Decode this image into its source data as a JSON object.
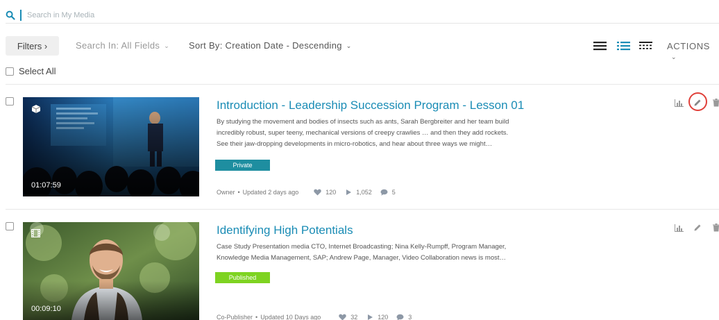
{
  "colors": {
    "accent": "#1a8cb5",
    "private_badge": "#1e8ea0",
    "published_badge": "#7ed321",
    "highlight_circle": "#e0403a"
  },
  "search": {
    "placeholder": "Search in My Media",
    "icon": "search-icon"
  },
  "toolbar": {
    "filters_label": "Filters ›",
    "search_in_label": "Search In: All Fields",
    "sort_by_label": "Sort By: Creation Date - Descending",
    "view_icons": [
      "details-view-icon",
      "list-view-icon",
      "compact-view-icon"
    ],
    "actions_label": "ACTIONS"
  },
  "select_all_label": "Select All",
  "entries": [
    {
      "title": "Introduction - Leadership Succession Program - Lesson 01",
      "description_lines": [
        "By studying the movement and bodies of insects such as ants, Sarah Bergbreiter and her team build",
        "incredibly robust, super teeny, mechanical versions of creepy crawlies … and then they add rockets.",
        "See their jaw-dropping developments in micro-robotics, and hear about three ways we might…"
      ],
      "status": "Private",
      "duration": "01:07:59",
      "type_icon": "cube-icon",
      "role": "Owner",
      "updated": "Updated 2 days ago",
      "likes": "120",
      "plays": "1,052",
      "comments": "5",
      "actions": [
        "analytics-icon",
        "edit-icon",
        "delete-icon"
      ]
    },
    {
      "title": "Identifying High Potentials",
      "description_lines": [
        "Case Study Presentation media CTO, Internet Broadcasting; Nina Kelly-Rumpff, Program Manager,",
        "Knowledge  Media Management, SAP; Andrew Page, Manager, Video Collaboration news is most…"
      ],
      "status": "Published",
      "duration": "00:09:10",
      "type_icon": "film-icon",
      "role": "Co-Publisher",
      "updated": "Updated 10 Days ago",
      "likes": "32",
      "plays": "120",
      "comments": "3",
      "actions": [
        "analytics-icon",
        "edit-icon",
        "delete-icon"
      ]
    }
  ]
}
